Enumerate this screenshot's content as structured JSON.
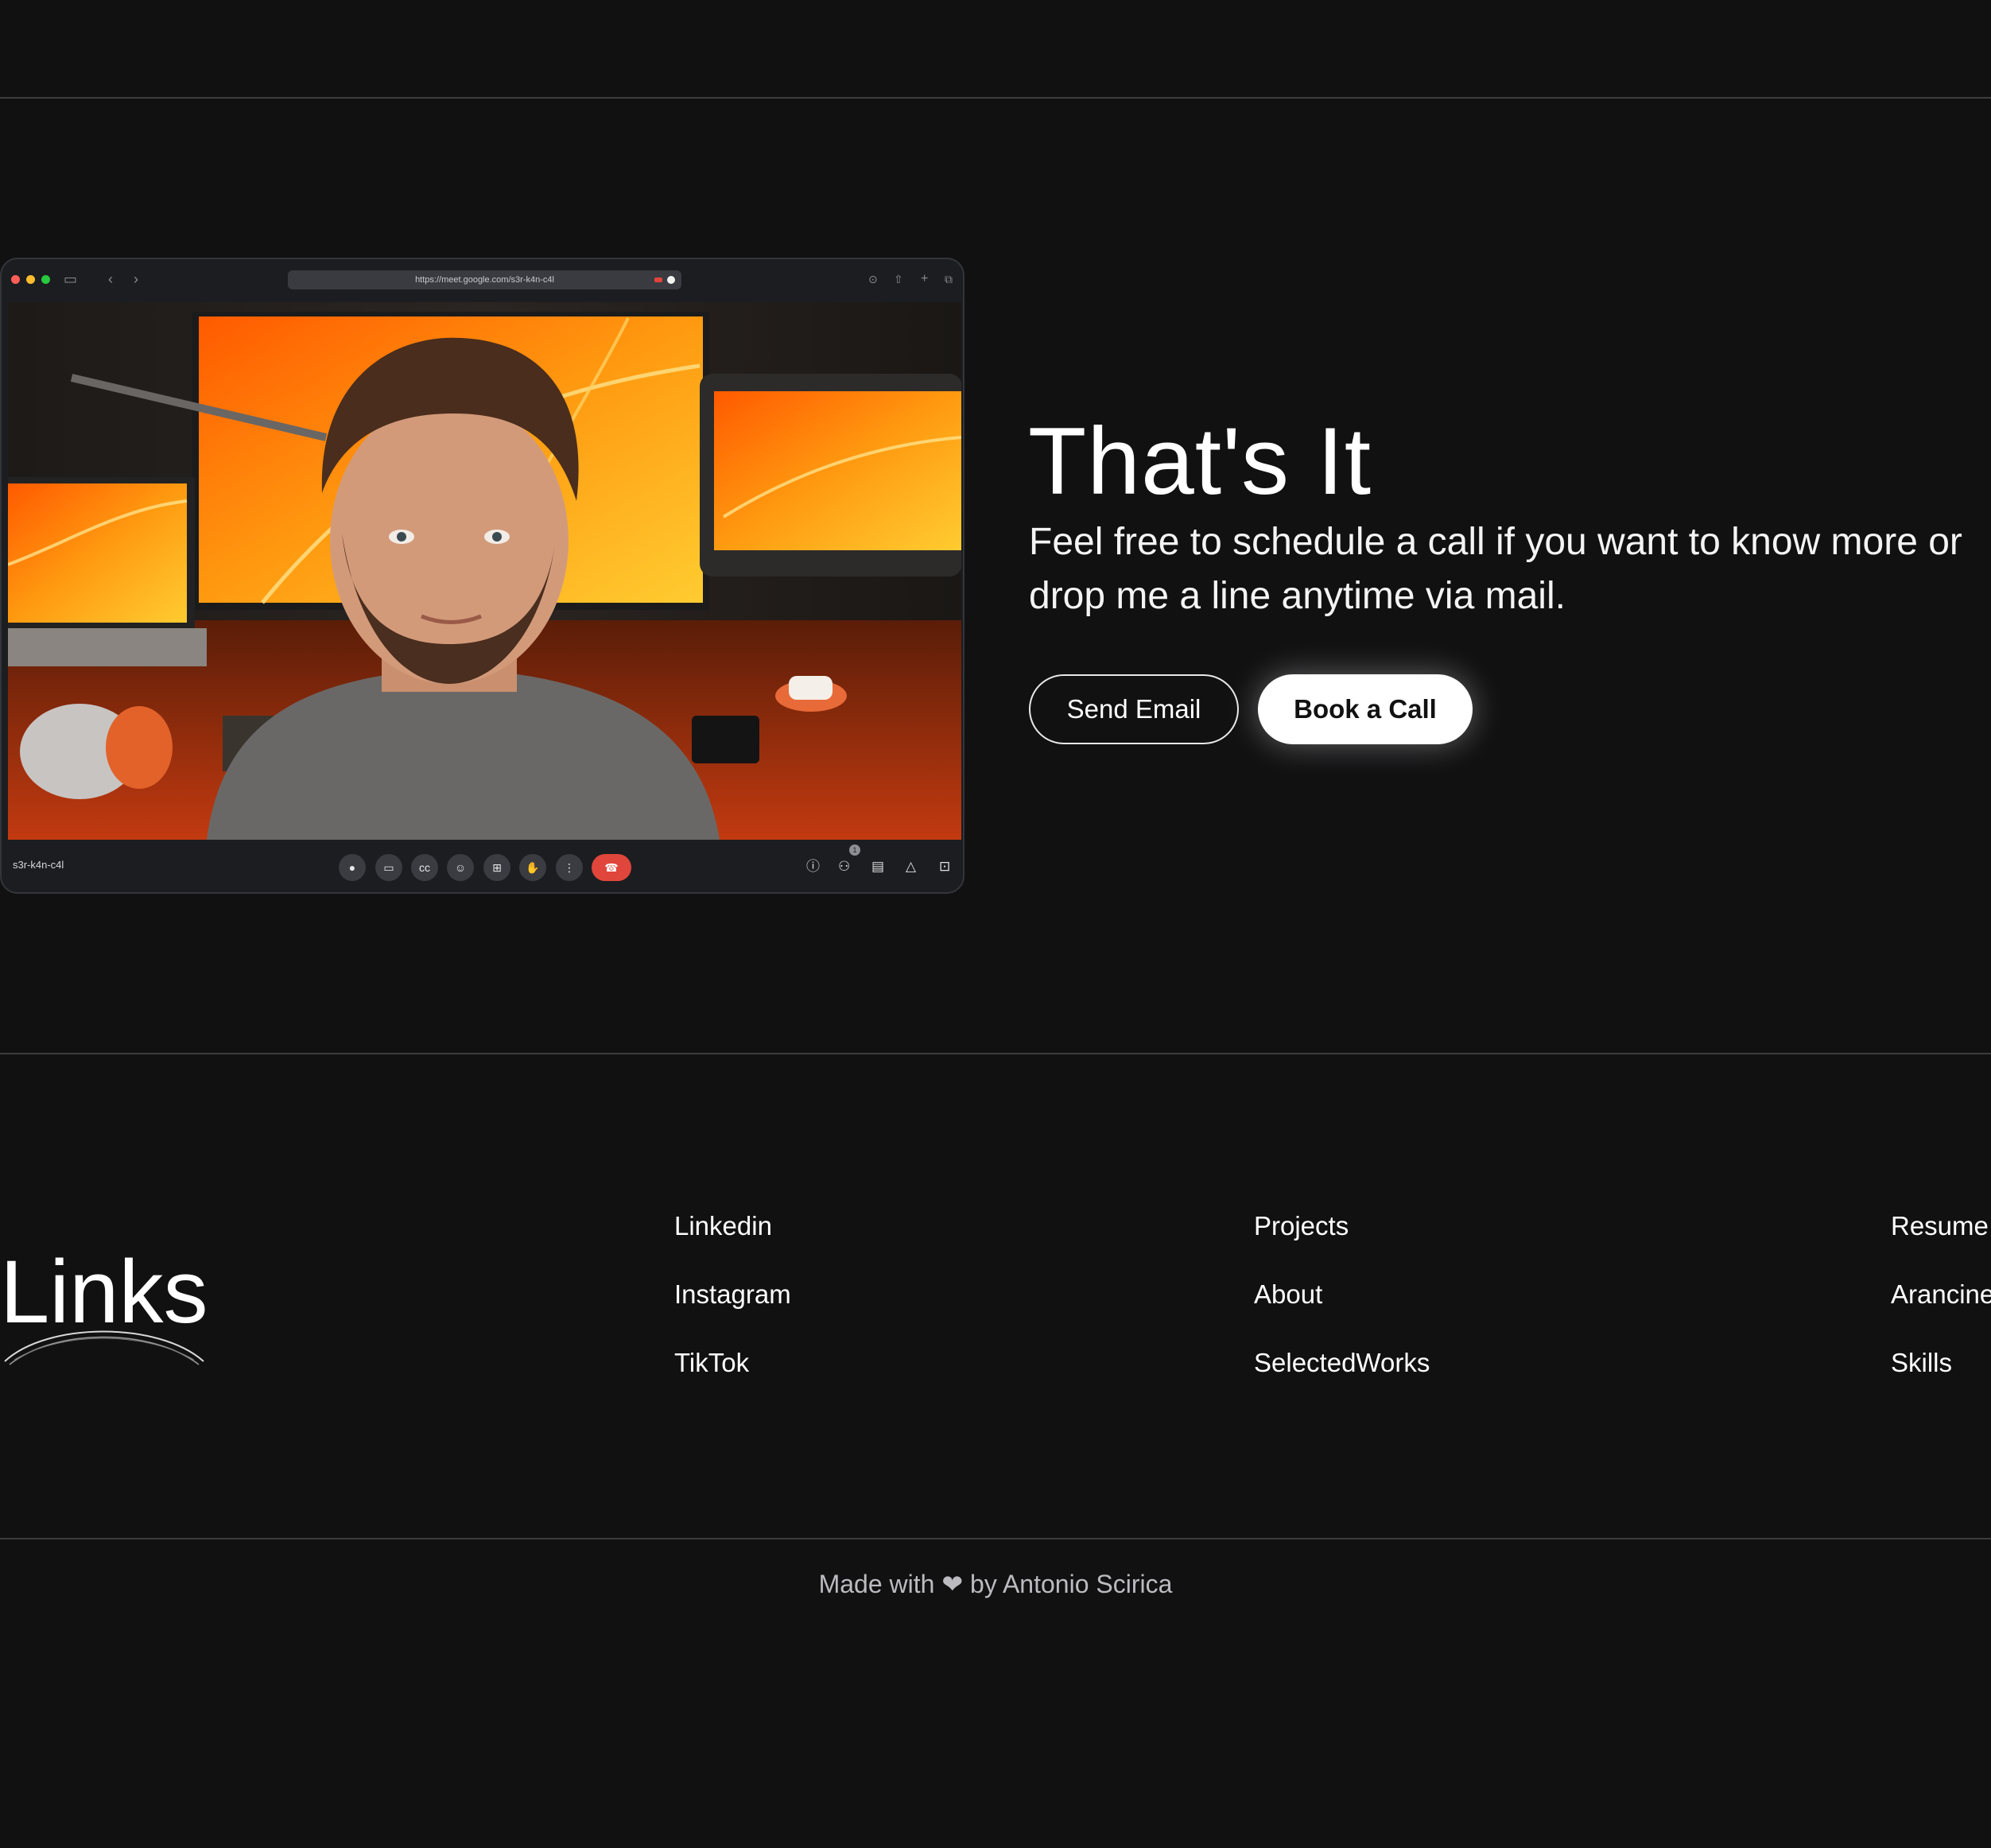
{
  "video_call": {
    "url": "https://meet.google.com/s3r-k4n-c4l",
    "meeting_code": "s3r-k4n-c4l",
    "participants_badge": "1",
    "controls": [
      "mic-icon",
      "camera-icon",
      "captions-icon",
      "emoji-icon",
      "present-icon",
      "raise-hand-icon",
      "more-options-icon",
      "end-call-icon"
    ],
    "side_controls": [
      "info-icon",
      "people-icon",
      "chat-icon",
      "activities-icon",
      "host-controls-icon"
    ]
  },
  "cta": {
    "title": "That's It",
    "text": "Feel free to schedule a call if you want to know more or drop me a line anytime via mail.",
    "send_email_label": "Send Email",
    "book_call_label": "Book a Call"
  },
  "links": {
    "heading": "Links",
    "column1": [
      "Linkedin",
      "Instagram",
      "TikTok"
    ],
    "column2": [
      "Projects",
      "About",
      "SelectedWorks"
    ],
    "column3": [
      "Resume",
      "Arancine",
      "Skills"
    ]
  },
  "footer": {
    "credit": "Made with ❤ by Antonio Scirica"
  },
  "colors": {
    "background": "#111112",
    "divider": "#3d3d40",
    "end_call": "#e0463b",
    "screen_orange": "#ff7a00"
  }
}
